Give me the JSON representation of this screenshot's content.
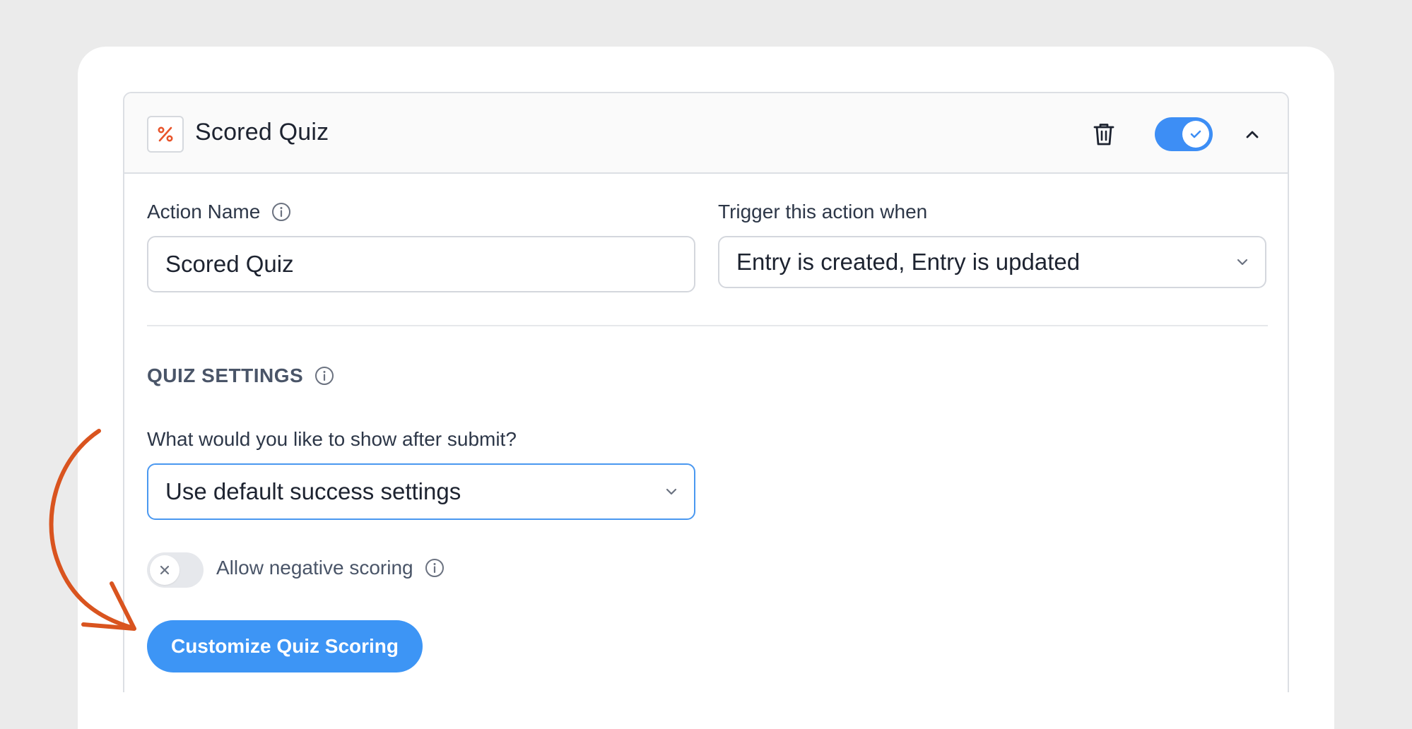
{
  "colors": {
    "accent": "#3d8ef5",
    "arrow": "#d9541f",
    "type_icon": "#e8542a"
  },
  "action": {
    "title": "Scored Quiz",
    "type_icon": "percent-icon",
    "enabled": true
  },
  "fields": {
    "action_name_label": "Action Name",
    "action_name_value": "Scored Quiz",
    "trigger_label": "Trigger this action when",
    "trigger_value": "Entry is created, Entry is updated"
  },
  "quiz_settings": {
    "section_title": "QUIZ SETTINGS",
    "after_submit_label": "What would you like to show after submit?",
    "after_submit_value": "Use default success settings",
    "negative_scoring_label": "Allow negative scoring",
    "negative_scoring_enabled": false,
    "customize_button": "Customize Quiz Scoring"
  }
}
